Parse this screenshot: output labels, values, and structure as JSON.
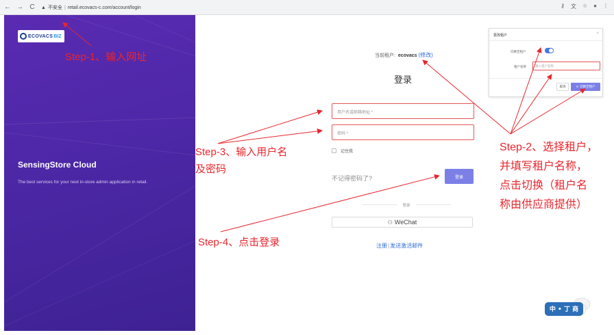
{
  "browser": {
    "back_icon": "back-arrow-icon",
    "forward_icon": "forward-arrow-icon",
    "reload_icon": "reload-icon",
    "security_label": "不安全",
    "url": "retail.ecovacs-c.com/account/login",
    "toolbar_icons": [
      "key-icon",
      "translate-icon",
      "star-icon",
      "profile-icon",
      "menu-icon"
    ]
  },
  "brand": {
    "logo_text": "ECOVACS",
    "logo_suffix": "BIZ",
    "title": "SensingStore Cloud",
    "subtitle": "The best services for your next in-store admin application in retail."
  },
  "login": {
    "tenant_prefix": "当前租户:",
    "tenant_name": "ecovacs",
    "tenant_change": "(修改)",
    "title": "登录",
    "username_placeholder": "用户名或邮箱地址 *",
    "password_placeholder": "密码 *",
    "remember_label": "记住我",
    "forgot_label": "不记得密码了?",
    "login_button": "登录",
    "divider_label": "登录",
    "wechat_label": "WeChat",
    "register_link": "注册",
    "pipe": "|",
    "activation_link": "发送激活邮件"
  },
  "tenant_modal": {
    "title": "更改租户",
    "close": "×",
    "switch_label": "切换至租户",
    "name_label": "租户名称",
    "name_placeholder": "输入租户名称",
    "cancel_button": "取消",
    "switch_button": "切换至租户"
  },
  "annotations": {
    "step1": "Step-1、输入网址",
    "step2": [
      "Step-2、选择租户，",
      "并填写租户名称，",
      "点击切换（租户名",
      "称由供应商提供）"
    ],
    "step3": [
      "Step-3、输入用户名",
      "及密码"
    ],
    "step4": "Step-4、点击登录"
  },
  "watermark": {
    "text": "中 • 丁 商"
  },
  "colors": {
    "purple_panel": "#4c27a6",
    "annotation_red": "#e8262d",
    "button_purple": "#7b7fe6",
    "link_blue": "#2f6bd9",
    "error_border": "#e25555"
  }
}
